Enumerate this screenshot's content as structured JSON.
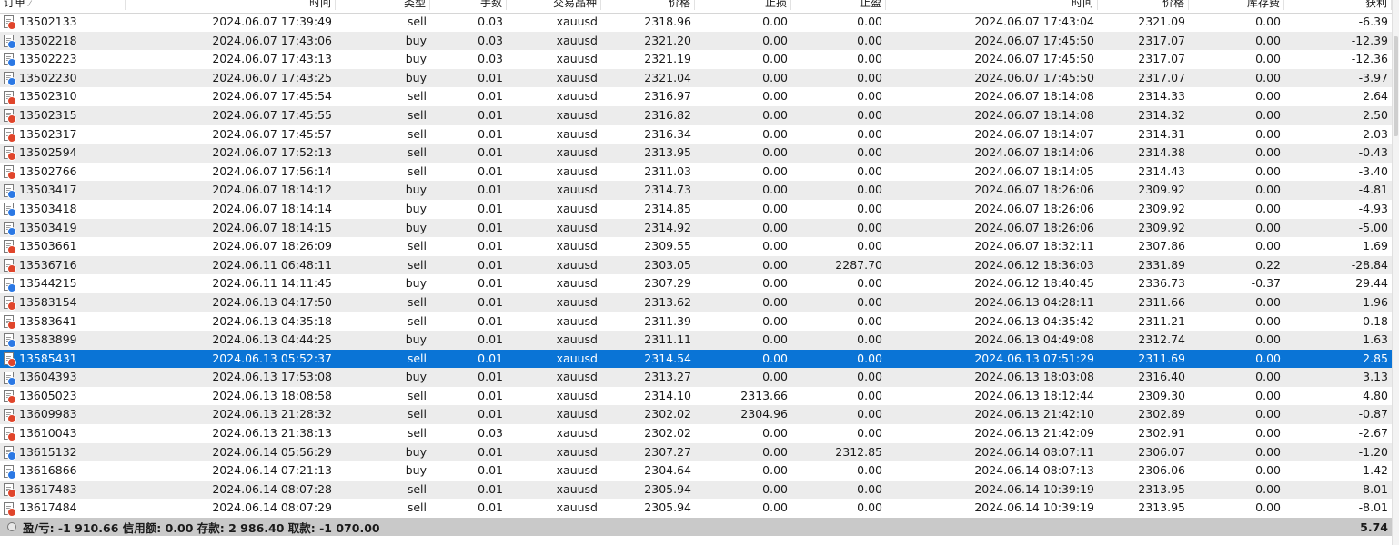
{
  "columns": [
    "订单",
    "时间",
    "类型",
    "手数",
    "交易品种",
    "价格",
    "止损",
    "止盈",
    "时间",
    "价格",
    "库存费",
    "获利"
  ],
  "selected_order": "13585431",
  "rows": [
    {
      "order": "13502133",
      "open_time": "2024.06.07 17:39:49",
      "type": "sell",
      "lots": "0.03",
      "symbol": "xauusd",
      "open_price": "2318.96",
      "sl": "0.00",
      "tp": "0.00",
      "close_time": "2024.06.07 17:43:04",
      "close_price": "2321.09",
      "swap": "0.00",
      "profit": "-6.39"
    },
    {
      "order": "13502218",
      "open_time": "2024.06.07 17:43:06",
      "type": "buy",
      "lots": "0.03",
      "symbol": "xauusd",
      "open_price": "2321.20",
      "sl": "0.00",
      "tp": "0.00",
      "close_time": "2024.06.07 17:45:50",
      "close_price": "2317.07",
      "swap": "0.00",
      "profit": "-12.39"
    },
    {
      "order": "13502223",
      "open_time": "2024.06.07 17:43:13",
      "type": "buy",
      "lots": "0.03",
      "symbol": "xauusd",
      "open_price": "2321.19",
      "sl": "0.00",
      "tp": "0.00",
      "close_time": "2024.06.07 17:45:50",
      "close_price": "2317.07",
      "swap": "0.00",
      "profit": "-12.36"
    },
    {
      "order": "13502230",
      "open_time": "2024.06.07 17:43:25",
      "type": "buy",
      "lots": "0.01",
      "symbol": "xauusd",
      "open_price": "2321.04",
      "sl": "0.00",
      "tp": "0.00",
      "close_time": "2024.06.07 17:45:50",
      "close_price": "2317.07",
      "swap": "0.00",
      "profit": "-3.97"
    },
    {
      "order": "13502310",
      "open_time": "2024.06.07 17:45:54",
      "type": "sell",
      "lots": "0.01",
      "symbol": "xauusd",
      "open_price": "2316.97",
      "sl": "0.00",
      "tp": "0.00",
      "close_time": "2024.06.07 18:14:08",
      "close_price": "2314.33",
      "swap": "0.00",
      "profit": "2.64"
    },
    {
      "order": "13502315",
      "open_time": "2024.06.07 17:45:55",
      "type": "sell",
      "lots": "0.01",
      "symbol": "xauusd",
      "open_price": "2316.82",
      "sl": "0.00",
      "tp": "0.00",
      "close_time": "2024.06.07 18:14:08",
      "close_price": "2314.32",
      "swap": "0.00",
      "profit": "2.50"
    },
    {
      "order": "13502317",
      "open_time": "2024.06.07 17:45:57",
      "type": "sell",
      "lots": "0.01",
      "symbol": "xauusd",
      "open_price": "2316.34",
      "sl": "0.00",
      "tp": "0.00",
      "close_time": "2024.06.07 18:14:07",
      "close_price": "2314.31",
      "swap": "0.00",
      "profit": "2.03"
    },
    {
      "order": "13502594",
      "open_time": "2024.06.07 17:52:13",
      "type": "sell",
      "lots": "0.01",
      "symbol": "xauusd",
      "open_price": "2313.95",
      "sl": "0.00",
      "tp": "0.00",
      "close_time": "2024.06.07 18:14:06",
      "close_price": "2314.38",
      "swap": "0.00",
      "profit": "-0.43"
    },
    {
      "order": "13502766",
      "open_time": "2024.06.07 17:56:14",
      "type": "sell",
      "lots": "0.01",
      "symbol": "xauusd",
      "open_price": "2311.03",
      "sl": "0.00",
      "tp": "0.00",
      "close_time": "2024.06.07 18:14:05",
      "close_price": "2314.43",
      "swap": "0.00",
      "profit": "-3.40"
    },
    {
      "order": "13503417",
      "open_time": "2024.06.07 18:14:12",
      "type": "buy",
      "lots": "0.01",
      "symbol": "xauusd",
      "open_price": "2314.73",
      "sl": "0.00",
      "tp": "0.00",
      "close_time": "2024.06.07 18:26:06",
      "close_price": "2309.92",
      "swap": "0.00",
      "profit": "-4.81"
    },
    {
      "order": "13503418",
      "open_time": "2024.06.07 18:14:14",
      "type": "buy",
      "lots": "0.01",
      "symbol": "xauusd",
      "open_price": "2314.85",
      "sl": "0.00",
      "tp": "0.00",
      "close_time": "2024.06.07 18:26:06",
      "close_price": "2309.92",
      "swap": "0.00",
      "profit": "-4.93"
    },
    {
      "order": "13503419",
      "open_time": "2024.06.07 18:14:15",
      "type": "buy",
      "lots": "0.01",
      "symbol": "xauusd",
      "open_price": "2314.92",
      "sl": "0.00",
      "tp": "0.00",
      "close_time": "2024.06.07 18:26:06",
      "close_price": "2309.92",
      "swap": "0.00",
      "profit": "-5.00"
    },
    {
      "order": "13503661",
      "open_time": "2024.06.07 18:26:09",
      "type": "sell",
      "lots": "0.01",
      "symbol": "xauusd",
      "open_price": "2309.55",
      "sl": "0.00",
      "tp": "0.00",
      "close_time": "2024.06.07 18:32:11",
      "close_price": "2307.86",
      "swap": "0.00",
      "profit": "1.69"
    },
    {
      "order": "13536716",
      "open_time": "2024.06.11 06:48:11",
      "type": "sell",
      "lots": "0.01",
      "symbol": "xauusd",
      "open_price": "2303.05",
      "sl": "0.00",
      "tp": "2287.70",
      "close_time": "2024.06.12 18:36:03",
      "close_price": "2331.89",
      "swap": "0.22",
      "profit": "-28.84"
    },
    {
      "order": "13544215",
      "open_time": "2024.06.11 14:11:45",
      "type": "buy",
      "lots": "0.01",
      "symbol": "xauusd",
      "open_price": "2307.29",
      "sl": "0.00",
      "tp": "0.00",
      "close_time": "2024.06.12 18:40:45",
      "close_price": "2336.73",
      "swap": "-0.37",
      "profit": "29.44"
    },
    {
      "order": "13583154",
      "open_time": "2024.06.13 04:17:50",
      "type": "sell",
      "lots": "0.01",
      "symbol": "xauusd",
      "open_price": "2313.62",
      "sl": "0.00",
      "tp": "0.00",
      "close_time": "2024.06.13 04:28:11",
      "close_price": "2311.66",
      "swap": "0.00",
      "profit": "1.96"
    },
    {
      "order": "13583641",
      "open_time": "2024.06.13 04:35:18",
      "type": "sell",
      "lots": "0.01",
      "symbol": "xauusd",
      "open_price": "2311.39",
      "sl": "0.00",
      "tp": "0.00",
      "close_time": "2024.06.13 04:35:42",
      "close_price": "2311.21",
      "swap": "0.00",
      "profit": "0.18"
    },
    {
      "order": "13583899",
      "open_time": "2024.06.13 04:44:25",
      "type": "buy",
      "lots": "0.01",
      "symbol": "xauusd",
      "open_price": "2311.11",
      "sl": "0.00",
      "tp": "0.00",
      "close_time": "2024.06.13 04:49:08",
      "close_price": "2312.74",
      "swap": "0.00",
      "profit": "1.63"
    },
    {
      "order": "13585431",
      "open_time": "2024.06.13 05:52:37",
      "type": "sell",
      "lots": "0.01",
      "symbol": "xauusd",
      "open_price": "2314.54",
      "sl": "0.00",
      "tp": "0.00",
      "close_time": "2024.06.13 07:51:29",
      "close_price": "2311.69",
      "swap": "0.00",
      "profit": "2.85"
    },
    {
      "order": "13604393",
      "open_time": "2024.06.13 17:53:08",
      "type": "buy",
      "lots": "0.01",
      "symbol": "xauusd",
      "open_price": "2313.27",
      "sl": "0.00",
      "tp": "0.00",
      "close_time": "2024.06.13 18:03:08",
      "close_price": "2316.40",
      "swap": "0.00",
      "profit": "3.13"
    },
    {
      "order": "13605023",
      "open_time": "2024.06.13 18:08:58",
      "type": "sell",
      "lots": "0.01",
      "symbol": "xauusd",
      "open_price": "2314.10",
      "sl": "2313.66",
      "tp": "0.00",
      "close_time": "2024.06.13 18:12:44",
      "close_price": "2309.30",
      "swap": "0.00",
      "profit": "4.80"
    },
    {
      "order": "13609983",
      "open_time": "2024.06.13 21:28:32",
      "type": "sell",
      "lots": "0.01",
      "symbol": "xauusd",
      "open_price": "2302.02",
      "sl": "2304.96",
      "tp": "0.00",
      "close_time": "2024.06.13 21:42:10",
      "close_price": "2302.89",
      "swap": "0.00",
      "profit": "-0.87"
    },
    {
      "order": "13610043",
      "open_time": "2024.06.13 21:38:13",
      "type": "sell",
      "lots": "0.03",
      "symbol": "xauusd",
      "open_price": "2302.02",
      "sl": "0.00",
      "tp": "0.00",
      "close_time": "2024.06.13 21:42:09",
      "close_price": "2302.91",
      "swap": "0.00",
      "profit": "-2.67"
    },
    {
      "order": "13615132",
      "open_time": "2024.06.14 05:56:29",
      "type": "buy",
      "lots": "0.01",
      "symbol": "xauusd",
      "open_price": "2307.27",
      "sl": "0.00",
      "tp": "2312.85",
      "close_time": "2024.06.14 08:07:11",
      "close_price": "2306.07",
      "swap": "0.00",
      "profit": "-1.20"
    },
    {
      "order": "13616866",
      "open_time": "2024.06.14 07:21:13",
      "type": "buy",
      "lots": "0.01",
      "symbol": "xauusd",
      "open_price": "2304.64",
      "sl": "0.00",
      "tp": "0.00",
      "close_time": "2024.06.14 08:07:13",
      "close_price": "2306.06",
      "swap": "0.00",
      "profit": "1.42"
    },
    {
      "order": "13617483",
      "open_time": "2024.06.14 08:07:28",
      "type": "sell",
      "lots": "0.01",
      "symbol": "xauusd",
      "open_price": "2305.94",
      "sl": "0.00",
      "tp": "0.00",
      "close_time": "2024.06.14 10:39:19",
      "close_price": "2313.95",
      "swap": "0.00",
      "profit": "-8.01"
    },
    {
      "order": "13617484",
      "open_time": "2024.06.14 08:07:29",
      "type": "sell",
      "lots": "0.01",
      "symbol": "xauusd",
      "open_price": "2305.94",
      "sl": "0.00",
      "tp": "0.00",
      "close_time": "2024.06.14 10:39:19",
      "close_price": "2313.95",
      "swap": "0.00",
      "profit": "-8.01"
    }
  ],
  "footer": {
    "summary": "盈/亏: -1 910.66  信用额: 0.00  存款: 2 986.40  取款: -1 070.00",
    "total_profit": "5.74"
  },
  "icons": {
    "row_icon": "order-document-icon",
    "sell_color": "#e0452b",
    "buy_color": "#2b78e4",
    "selected_row_color": "#0a74d6"
  }
}
